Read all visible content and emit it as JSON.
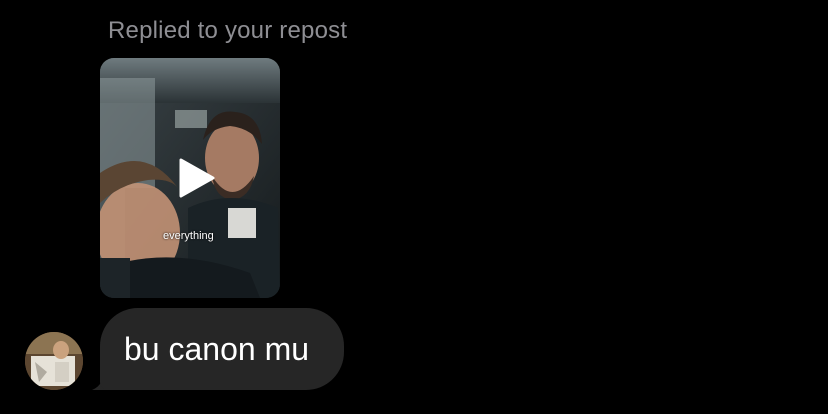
{
  "reply_context": "Replied to your repost",
  "repost": {
    "caption": "everything",
    "media_type": "video",
    "play_icon": "play-icon"
  },
  "message": {
    "text": "bu canon mu",
    "bubble_color": "#262626",
    "text_color": "#ffffff"
  },
  "colors": {
    "background": "#000000",
    "muted_text": "#8e8e93"
  }
}
